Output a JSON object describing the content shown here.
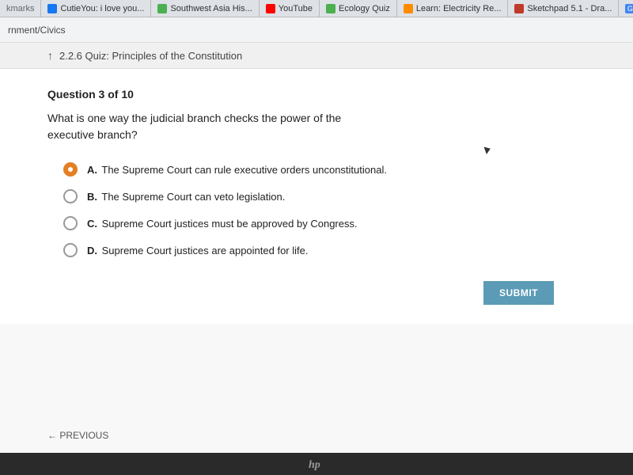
{
  "browser": {
    "tabs": [
      {
        "id": "bookmarks",
        "label": "kmarks",
        "icon": "generic",
        "active": false
      },
      {
        "id": "cutie",
        "label": "CutieYou: i love you...",
        "icon": "facebook",
        "active": false
      },
      {
        "id": "southwest",
        "label": "Southwest Asia His...",
        "icon": "green",
        "active": false
      },
      {
        "id": "youtube",
        "label": "YouTube",
        "icon": "youtube",
        "active": false
      },
      {
        "id": "ecology",
        "label": "Ecology Quiz",
        "icon": "green2",
        "active": false
      },
      {
        "id": "learn",
        "label": "Learn: Electricity Re...",
        "icon": "orange",
        "active": false
      },
      {
        "id": "sketchpad",
        "label": "Sketchpad 5.1 - Dra...",
        "icon": "sketchpad",
        "active": false
      },
      {
        "id": "country",
        "label": "G country artis...",
        "icon": "google",
        "active": false
      }
    ],
    "breadcrumb": "rnment/Civics"
  },
  "quiz": {
    "header_icon": "↑",
    "header_title": "2.2.6 Quiz: Principles of the Constitution",
    "question_label": "Question 3 of 10",
    "question_text": "What is one way the judicial branch checks the power of the executive branch?",
    "options": [
      {
        "id": "A",
        "text": "The Supreme Court can rule executive orders unconstitutional.",
        "selected": true
      },
      {
        "id": "B",
        "text": "The Supreme Court can veto legislation.",
        "selected": false
      },
      {
        "id": "C",
        "text": "Supreme Court justices must be approved by Congress.",
        "selected": false
      },
      {
        "id": "D",
        "text": "Supreme Court justices are appointed for life.",
        "selected": false
      }
    ],
    "submit_label": "SUBMIT",
    "previous_label": "← PREVIOUS"
  },
  "laptop": {
    "brand": "hp"
  }
}
